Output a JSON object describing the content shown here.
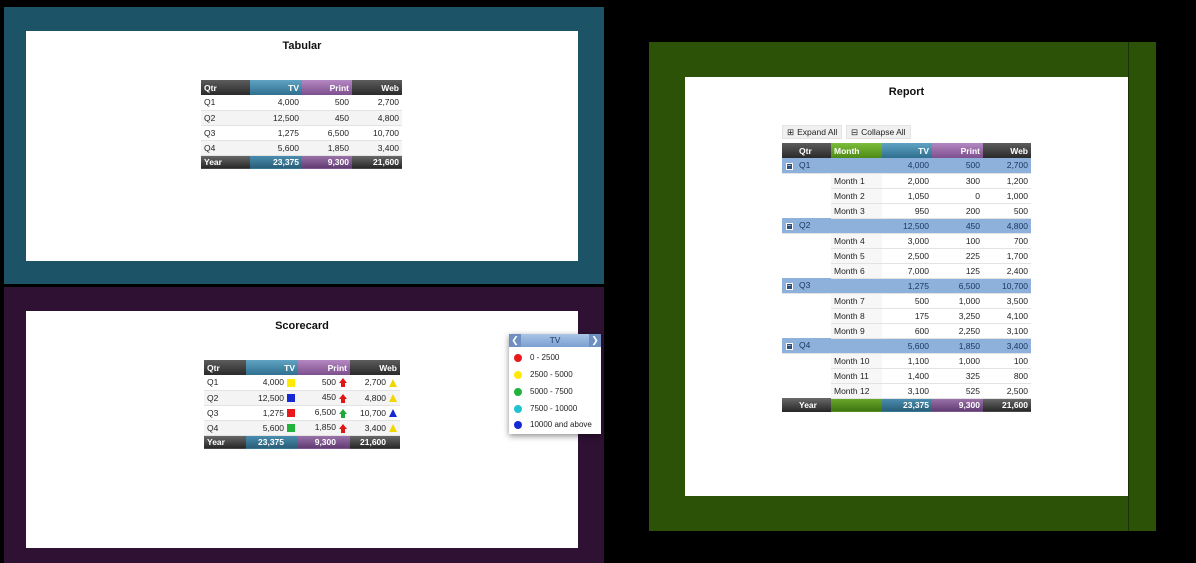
{
  "tabular": {
    "title": "Tabular",
    "headers": [
      "Qtr",
      "TV",
      "Print",
      "Web"
    ],
    "rows": [
      [
        "Q1",
        "4,000",
        "500",
        "2,700"
      ],
      [
        "Q2",
        "12,500",
        "450",
        "4,800"
      ],
      [
        "Q3",
        "1,275",
        "6,500",
        "10,700"
      ],
      [
        "Q4",
        "5,600",
        "1,850",
        "3,400"
      ]
    ],
    "total": [
      "Year",
      "23,375",
      "9,300",
      "21,600"
    ]
  },
  "scorecard": {
    "title": "Scorecard",
    "headers": [
      "Qtr",
      "TV",
      "Print",
      "Web"
    ],
    "rows": [
      {
        "qtr": "Q1",
        "tv": "4,000",
        "print": "500",
        "web": "2,700"
      },
      {
        "qtr": "Q2",
        "tv": "12,500",
        "print": "450",
        "web": "4,800"
      },
      {
        "qtr": "Q3",
        "tv": "1,275",
        "print": "6,500",
        "web": "10,700"
      },
      {
        "qtr": "Q4",
        "tv": "5,600",
        "print": "1,850",
        "web": "3,400"
      }
    ],
    "indicators": [
      {
        "tv": "yellow-square-icon",
        "print": "red-up-arrow-icon",
        "web": "yellow-triangle-icon"
      },
      {
        "tv": "blue-square-icon",
        "print": "red-up-arrow-icon",
        "web": "yellow-triangle-icon"
      },
      {
        "tv": "red-square-icon",
        "print": "green-up-arrow-icon",
        "web": "blue-triangle-icon"
      },
      {
        "tv": "green-square-icon",
        "print": "red-up-arrow-icon",
        "web": "yellow-triangle-icon"
      }
    ],
    "total": [
      "Year",
      "23,375",
      "9,300",
      "21,600"
    ],
    "legend": {
      "title": "TV",
      "prev_icon": "chevron-left-icon",
      "next_icon": "chevron-right-icon",
      "items": [
        {
          "label": "0 - 2500",
          "color": "#e8191b"
        },
        {
          "label": "2500 - 5000",
          "color": "#ffea00"
        },
        {
          "label": "5000 - 7500",
          "color": "#22b33c"
        },
        {
          "label": "7500 - 10000",
          "color": "#1fc4cf"
        },
        {
          "label": "10000 and above",
          "color": "#1428d4"
        }
      ]
    }
  },
  "report": {
    "title": "Report",
    "expand_all": "Expand All",
    "collapse_all": "Collapse All",
    "expand_icon": "⊞",
    "collapse_icon": "⊟",
    "headers": [
      "Qtr",
      "Month",
      "TV",
      "Print",
      "Web"
    ],
    "groups": [
      {
        "qtr": "Q1",
        "tv": "4,000",
        "print": "500",
        "web": "2,700",
        "months": [
          {
            "month": "Month 1",
            "tv": "2,000",
            "print": "300",
            "web": "1,200"
          },
          {
            "month": "Month 2",
            "tv": "1,050",
            "print": "0",
            "web": "1,000"
          },
          {
            "month": "Month 3",
            "tv": "950",
            "print": "200",
            "web": "500"
          }
        ]
      },
      {
        "qtr": "Q2",
        "tv": "12,500",
        "print": "450",
        "web": "4,800",
        "months": [
          {
            "month": "Month 4",
            "tv": "3,000",
            "print": "100",
            "web": "700"
          },
          {
            "month": "Month 5",
            "tv": "2,500",
            "print": "225",
            "web": "1,700"
          },
          {
            "month": "Month 6",
            "tv": "7,000",
            "print": "125",
            "web": "2,400"
          }
        ]
      },
      {
        "qtr": "Q3",
        "tv": "1,275",
        "print": "6,500",
        "web": "10,700",
        "months": [
          {
            "month": "Month 7",
            "tv": "500",
            "print": "1,000",
            "web": "3,500"
          },
          {
            "month": "Month 8",
            "tv": "175",
            "print": "3,250",
            "web": "4,100"
          },
          {
            "month": "Month 9",
            "tv": "600",
            "print": "2,250",
            "web": "3,100"
          }
        ]
      },
      {
        "qtr": "Q4",
        "tv": "5,600",
        "print": "1,850",
        "web": "3,400",
        "months": [
          {
            "month": "Month 10",
            "tv": "1,100",
            "print": "1,000",
            "web": "100"
          },
          {
            "month": "Month 11",
            "tv": "1,400",
            "print": "325",
            "web": "800"
          },
          {
            "month": "Month 12",
            "tv": "3,100",
            "print": "525",
            "web": "2,500"
          }
        ]
      }
    ],
    "total": [
      "Year",
      "",
      "23,375",
      "9,300",
      "21,600"
    ]
  },
  "colors": {
    "tabular_bg": "#1d5366",
    "scorecard_bg": "#2e1133",
    "report_bg": "#2b5206",
    "tv_header": "#2f6f8f",
    "print_header": "#7d4f8e",
    "month_header": "#4d8a16",
    "group_row": "#8db1db"
  }
}
